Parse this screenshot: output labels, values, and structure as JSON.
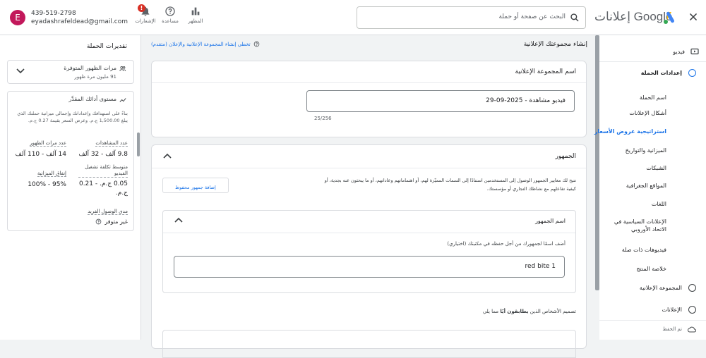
{
  "account": {
    "initial": "E",
    "phone": "439-519-2798",
    "email": "eyadashrafeldead@gmail.com"
  },
  "toolbar": {
    "notifications_label": "الإشعارات",
    "notifications_badge": "!",
    "help_label": "مساعدة",
    "appearance_label": "المظهر"
  },
  "search": {
    "placeholder": "البحث عن صفحة أو حملة"
  },
  "brand": {
    "name": "إعلانات Google"
  },
  "left_panel": {
    "title": "تقديرات الحملة",
    "available_impressions": {
      "title": "مرات الظهور المتوفرة",
      "value": "91 مليون مرة ظهور"
    },
    "performance": {
      "title": "مستوى أدائك المقدَّر",
      "description": "بناءً على استهدافك وإعداداتك وإجمالي ميزانية حملتك الذي يبلغ 1,500.00 ج.م. وعرض السعر بقيمة 0.27 ج.م.",
      "metrics": [
        {
          "label": "عدد المشاهدات",
          "value": "9.8 آلف - 32 آلف"
        },
        {
          "label": "عدد مرات الظهور",
          "value": "14 آلف - 110 آلف"
        },
        {
          "label": "متوسط تكلفة تشغيل الفيديو",
          "value": "0.05 ج.م. - 0.21 ج.م."
        },
        {
          "label": "إنفاق الميزانية",
          "value": "95% - 100%"
        }
      ],
      "reach_label": "مدى الوصول الفريد",
      "reach_value": "غير متوفر"
    }
  },
  "header": {
    "page_title": "إنشاء مجموعتك الإعلانية",
    "skip_link": "تخطي إنشاء المجموعة الإعلانية والإعلان (متقدم)"
  },
  "ad_group_card": {
    "title": "اسم المجموعة الإعلانية",
    "name_value": "فيديو مشاهدة - 2025-09-29",
    "char_count": "25/256"
  },
  "audience_card": {
    "title": "الجمهور",
    "description": "تتيح لك معايير الجمهور الوصول إلى المستخدمين استنادًا إلى السمات المميّزة لهم، أو اهتماماتهم وعاداتهم، أو ما يبحثون عنه بجدية، أو كيفية تفاعلهم مع نشاطك التجاري أو مؤسستك.",
    "add_button": "إضافة جمهور محفوظ",
    "name_section": {
      "title": "اسم الجمهور",
      "hint": "أضف اسمًا لجمهورك من أجل حفظه في مكتبتك (اختياري)",
      "name_value": "red bite 1"
    },
    "design_prefix": "تصميم الأشخاص الذين ",
    "design_bold": "يطابقون أيًا",
    "design_suffix": " مما يلي"
  },
  "right_nav": {
    "top_item": "فيديو",
    "campaign_settings": "إعدادات الحملة",
    "sub_items": [
      "اسم الحملة",
      "أشكال الإعلانات",
      "استراتيجية عروض الأسعار",
      "الميزانية والتواريخ",
      "الشبكات",
      "المواقع الجغرافية",
      "اللغات",
      "الإعلانات السياسية في الاتحاد الأوروبي",
      "فيديوهات ذات صلة",
      "خلاصة المنتج"
    ],
    "active_sub_index": 2,
    "ad_group": "المجموعة الإعلانية",
    "ads": "الإعلانات",
    "footer": "تم الحفظ"
  },
  "colors": {
    "accent": "#1a73e8",
    "notification_red": "#d93025",
    "avatar": "#c2185b"
  }
}
